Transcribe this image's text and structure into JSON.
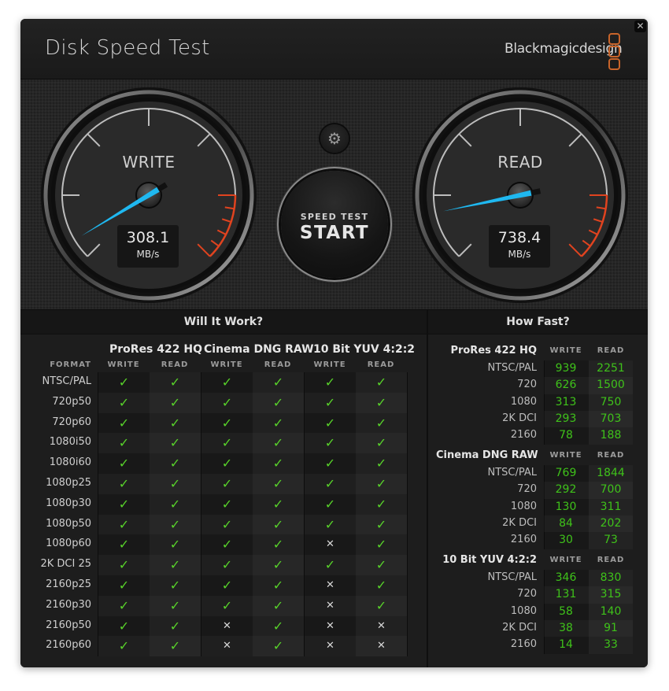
{
  "window": {
    "title": "Disk Speed Test",
    "brand": "Blackmagicdesign",
    "close_icon": "close-icon"
  },
  "gauges": {
    "write": {
      "label": "WRITE",
      "value": "308.1",
      "value_num": 308.1,
      "unit": "MB/s"
    },
    "read": {
      "label": "READ",
      "value": "738.4",
      "value_num": 738.4,
      "unit": "MB/s"
    },
    "needle_color": "#1fb8f0",
    "redzone_color": "#e0431f"
  },
  "controls": {
    "settings_icon": "gear-icon",
    "start_top": "SPEED TEST",
    "start_main": "START"
  },
  "will_it_work": {
    "title": "Will It Work?",
    "format_header": "FORMAT",
    "groups": [
      "ProRes 422 HQ",
      "Cinema DNG RAW",
      "10 Bit YUV 4:2:2"
    ],
    "subheaders": [
      "WRITE",
      "READ",
      "WRITE",
      "READ",
      "WRITE",
      "READ"
    ],
    "rows": [
      {
        "format": "NTSC/PAL",
        "results": [
          true,
          true,
          true,
          true,
          true,
          true
        ]
      },
      {
        "format": "720p50",
        "results": [
          true,
          true,
          true,
          true,
          true,
          true
        ]
      },
      {
        "format": "720p60",
        "results": [
          true,
          true,
          true,
          true,
          true,
          true
        ]
      },
      {
        "format": "1080i50",
        "results": [
          true,
          true,
          true,
          true,
          true,
          true
        ]
      },
      {
        "format": "1080i60",
        "results": [
          true,
          true,
          true,
          true,
          true,
          true
        ]
      },
      {
        "format": "1080p25",
        "results": [
          true,
          true,
          true,
          true,
          true,
          true
        ]
      },
      {
        "format": "1080p30",
        "results": [
          true,
          true,
          true,
          true,
          true,
          true
        ]
      },
      {
        "format": "1080p50",
        "results": [
          true,
          true,
          true,
          true,
          true,
          true
        ]
      },
      {
        "format": "1080p60",
        "results": [
          true,
          true,
          true,
          true,
          false,
          true
        ]
      },
      {
        "format": "2K DCI 25",
        "results": [
          true,
          true,
          true,
          true,
          true,
          true
        ]
      },
      {
        "format": "2160p25",
        "results": [
          true,
          true,
          true,
          true,
          false,
          true
        ]
      },
      {
        "format": "2160p30",
        "results": [
          true,
          true,
          true,
          true,
          false,
          true
        ]
      },
      {
        "format": "2160p50",
        "results": [
          true,
          true,
          false,
          true,
          false,
          false
        ]
      },
      {
        "format": "2160p60",
        "results": [
          true,
          true,
          false,
          true,
          false,
          false
        ]
      }
    ],
    "ok_symbol": "✓",
    "fail_symbol": "✕"
  },
  "how_fast": {
    "title": "How Fast?",
    "write_header": "WRITE",
    "read_header": "READ",
    "groups": [
      {
        "name": "ProRes 422 HQ",
        "rows": [
          {
            "format": "NTSC/PAL",
            "write": "939",
            "read": "2251"
          },
          {
            "format": "720",
            "write": "626",
            "read": "1500"
          },
          {
            "format": "1080",
            "write": "313",
            "read": "750"
          },
          {
            "format": "2K DCI",
            "write": "293",
            "read": "703"
          },
          {
            "format": "2160",
            "write": "78",
            "read": "188"
          }
        ]
      },
      {
        "name": "Cinema DNG RAW",
        "rows": [
          {
            "format": "NTSC/PAL",
            "write": "769",
            "read": "1844"
          },
          {
            "format": "720",
            "write": "292",
            "read": "700"
          },
          {
            "format": "1080",
            "write": "130",
            "read": "311"
          },
          {
            "format": "2K DCI",
            "write": "84",
            "read": "202"
          },
          {
            "format": "2160",
            "write": "30",
            "read": "73"
          }
        ]
      },
      {
        "name": "10 Bit YUV 4:2:2",
        "rows": [
          {
            "format": "NTSC/PAL",
            "write": "346",
            "read": "830"
          },
          {
            "format": "720",
            "write": "131",
            "read": "315"
          },
          {
            "format": "1080",
            "write": "58",
            "read": "140"
          },
          {
            "format": "2K DCI",
            "write": "38",
            "read": "91"
          },
          {
            "format": "2160",
            "write": "14",
            "read": "33"
          }
        ]
      }
    ]
  }
}
